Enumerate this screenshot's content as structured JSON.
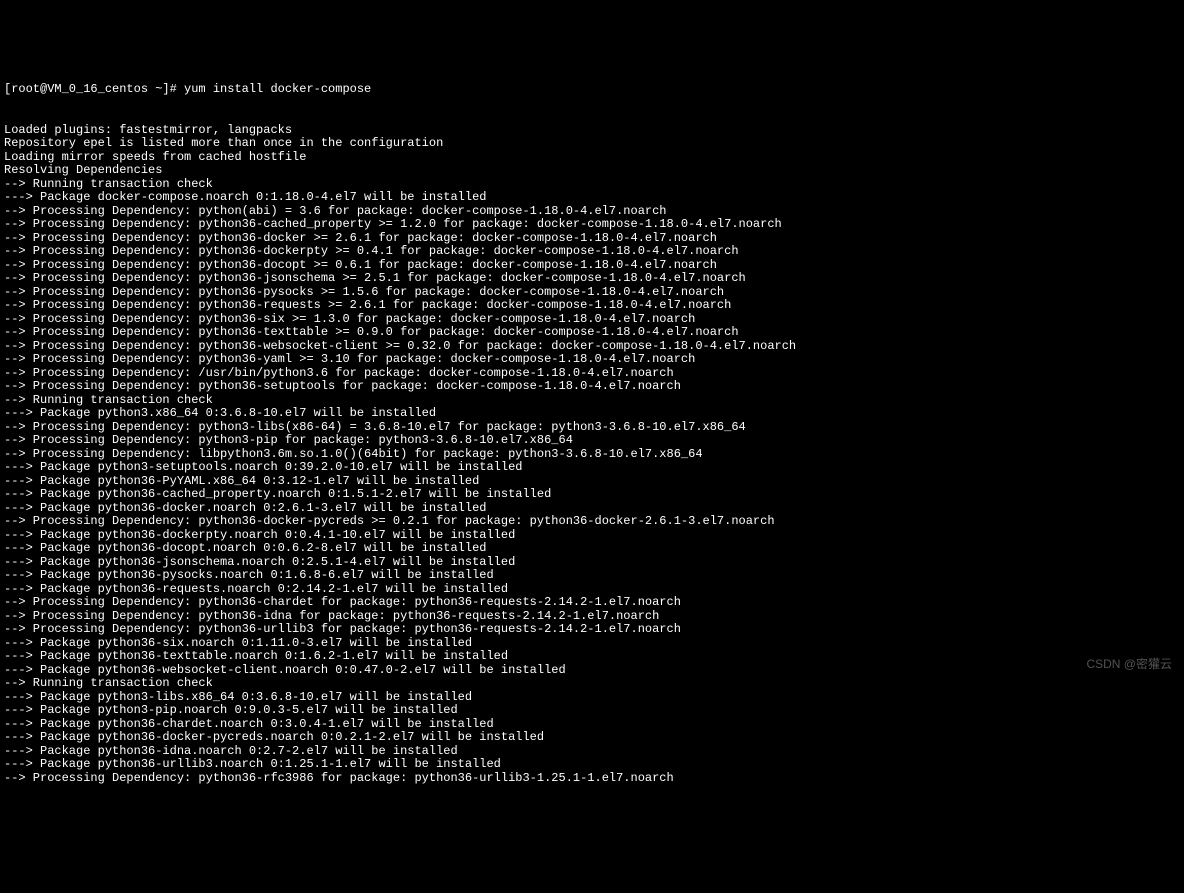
{
  "prompt_line": "[root@VM_0_16_centos ~]# yum install docker-compose",
  "lines": [
    "Loaded plugins: fastestmirror, langpacks",
    "Repository epel is listed more than once in the configuration",
    "Loading mirror speeds from cached hostfile",
    "Resolving Dependencies",
    "--> Running transaction check",
    "---> Package docker-compose.noarch 0:1.18.0-4.el7 will be installed",
    "--> Processing Dependency: python(abi) = 3.6 for package: docker-compose-1.18.0-4.el7.noarch",
    "--> Processing Dependency: python36-cached_property >= 1.2.0 for package: docker-compose-1.18.0-4.el7.noarch",
    "--> Processing Dependency: python36-docker >= 2.6.1 for package: docker-compose-1.18.0-4.el7.noarch",
    "--> Processing Dependency: python36-dockerpty >= 0.4.1 for package: docker-compose-1.18.0-4.el7.noarch",
    "--> Processing Dependency: python36-docopt >= 0.6.1 for package: docker-compose-1.18.0-4.el7.noarch",
    "--> Processing Dependency: python36-jsonschema >= 2.5.1 for package: docker-compose-1.18.0-4.el7.noarch",
    "--> Processing Dependency: python36-pysocks >= 1.5.6 for package: docker-compose-1.18.0-4.el7.noarch",
    "--> Processing Dependency: python36-requests >= 2.6.1 for package: docker-compose-1.18.0-4.el7.noarch",
    "--> Processing Dependency: python36-six >= 1.3.0 for package: docker-compose-1.18.0-4.el7.noarch",
    "--> Processing Dependency: python36-texttable >= 0.9.0 for package: docker-compose-1.18.0-4.el7.noarch",
    "--> Processing Dependency: python36-websocket-client >= 0.32.0 for package: docker-compose-1.18.0-4.el7.noarch",
    "--> Processing Dependency: python36-yaml >= 3.10 for package: docker-compose-1.18.0-4.el7.noarch",
    "--> Processing Dependency: /usr/bin/python3.6 for package: docker-compose-1.18.0-4.el7.noarch",
    "--> Processing Dependency: python36-setuptools for package: docker-compose-1.18.0-4.el7.noarch",
    "--> Running transaction check",
    "---> Package python3.x86_64 0:3.6.8-10.el7 will be installed",
    "--> Processing Dependency: python3-libs(x86-64) = 3.6.8-10.el7 for package: python3-3.6.8-10.el7.x86_64",
    "--> Processing Dependency: python3-pip for package: python3-3.6.8-10.el7.x86_64",
    "--> Processing Dependency: libpython3.6m.so.1.0()(64bit) for package: python3-3.6.8-10.el7.x86_64",
    "---> Package python3-setuptools.noarch 0:39.2.0-10.el7 will be installed",
    "---> Package python36-PyYAML.x86_64 0:3.12-1.el7 will be installed",
    "---> Package python36-cached_property.noarch 0:1.5.1-2.el7 will be installed",
    "---> Package python36-docker.noarch 0:2.6.1-3.el7 will be installed",
    "--> Processing Dependency: python36-docker-pycreds >= 0.2.1 for package: python36-docker-2.6.1-3.el7.noarch",
    "---> Package python36-dockerpty.noarch 0:0.4.1-10.el7 will be installed",
    "---> Package python36-docopt.noarch 0:0.6.2-8.el7 will be installed",
    "---> Package python36-jsonschema.noarch 0:2.5.1-4.el7 will be installed",
    "---> Package python36-pysocks.noarch 0:1.6.8-6.el7 will be installed",
    "---> Package python36-requests.noarch 0:2.14.2-1.el7 will be installed",
    "--> Processing Dependency: python36-chardet for package: python36-requests-2.14.2-1.el7.noarch",
    "--> Processing Dependency: python36-idna for package: python36-requests-2.14.2-1.el7.noarch",
    "--> Processing Dependency: python36-urllib3 for package: python36-requests-2.14.2-1.el7.noarch",
    "---> Package python36-six.noarch 0:1.11.0-3.el7 will be installed",
    "---> Package python36-texttable.noarch 0:1.6.2-1.el7 will be installed",
    "---> Package python36-websocket-client.noarch 0:0.47.0-2.el7 will be installed",
    "--> Running transaction check",
    "---> Package python3-libs.x86_64 0:3.6.8-10.el7 will be installed",
    "---> Package python3-pip.noarch 0:9.0.3-5.el7 will be installed",
    "---> Package python36-chardet.noarch 0:3.0.4-1.el7 will be installed",
    "---> Package python36-docker-pycreds.noarch 0:0.2.1-2.el7 will be installed",
    "---> Package python36-idna.noarch 0:2.7-2.el7 will be installed",
    "---> Package python36-urllib3.noarch 0:1.25.1-1.el7 will be installed",
    "--> Processing Dependency: python36-rfc3986 for package: python36-urllib3-1.25.1-1.el7.noarch"
  ],
  "watermark": "CSDN @密獾云"
}
